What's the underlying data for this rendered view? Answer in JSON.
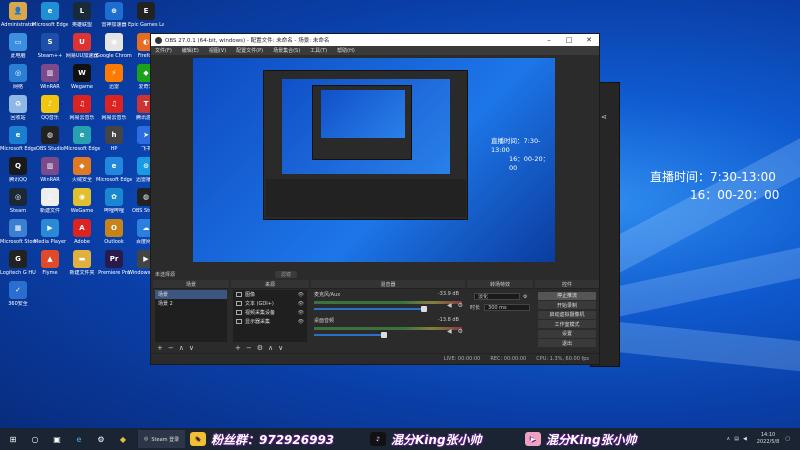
{
  "desktop": {
    "overlay_line1": "直播时间：7:30-13:00",
    "overlay_line2": "16：00-20：00",
    "icons": [
      {
        "label": "Administrator",
        "color": "#d9a64a",
        "glyph": "👤",
        "icon": "user-folder-icon"
      },
      {
        "label": "Microsoft Edge",
        "color": "#1f8fd6",
        "glyph": "e",
        "icon": "edge-icon"
      },
      {
        "label": "英雄联盟",
        "color": "#1a2a3a",
        "glyph": "L",
        "icon": "game-icon"
      },
      {
        "label": "雷神加速器",
        "color": "#1c6fd0",
        "glyph": "⊕",
        "icon": "accelerator-icon"
      },
      {
        "label": "Epic Games Launcher",
        "color": "#222",
        "glyph": "E",
        "icon": "epic-icon"
      },
      {
        "label": "此电脑",
        "color": "#3a8fe0",
        "glyph": "▭",
        "icon": "computer-icon"
      },
      {
        "label": "Steam++",
        "color": "#1d4fa8",
        "glyph": "S",
        "icon": "steam-plus-icon"
      },
      {
        "label": "网易UU加速器",
        "color": "#d33",
        "glyph": "U",
        "icon": "uu-icon"
      },
      {
        "label": "Google Chrome",
        "color": "#e5e5e5",
        "glyph": "◉",
        "icon": "chrome-icon"
      },
      {
        "label": "Firefox",
        "color": "#e86b22",
        "glyph": "◐",
        "icon": "firefox-icon"
      },
      {
        "label": "网络",
        "color": "#2a7fd4",
        "glyph": "◎",
        "icon": "network-icon"
      },
      {
        "label": "WinRAR",
        "color": "#7a4a8a",
        "glyph": "▥",
        "icon": "winrar-icon"
      },
      {
        "label": "Wegame",
        "color": "#111",
        "glyph": "W",
        "icon": "wegame-icon"
      },
      {
        "label": "迅雷",
        "color": "#ff7a00",
        "glyph": "⚡",
        "icon": "thunder-icon"
      },
      {
        "label": "爱奇艺",
        "color": "#1aa31a",
        "glyph": "◆",
        "icon": "iqiyi-icon"
      },
      {
        "label": "回收站",
        "color": "#8fb8e6",
        "glyph": "♻",
        "icon": "recycle-icon"
      },
      {
        "label": "QQ音乐",
        "color": "#f2c511",
        "glyph": "♪",
        "icon": "music-icon"
      },
      {
        "label": "网易云音乐",
        "color": "#d22",
        "glyph": "♫",
        "icon": "netease-icon"
      },
      {
        "label": "网易云音乐",
        "color": "#d22",
        "glyph": "♫",
        "icon": "netease2-icon"
      },
      {
        "label": "腾讯游戏",
        "color": "#c33",
        "glyph": "T",
        "icon": "tencent-icon"
      },
      {
        "label": "Microsoft Edge",
        "color": "#1a7fd0",
        "glyph": "e",
        "icon": "edge2-icon"
      },
      {
        "label": "OBS Studio",
        "color": "#222",
        "glyph": "◍",
        "icon": "obs-icon"
      },
      {
        "label": "Microsoft Edge",
        "color": "#27a0b0",
        "glyph": "e",
        "icon": "edge3-icon"
      },
      {
        "label": "HP",
        "color": "#444",
        "glyph": "h",
        "icon": "hp-icon"
      },
      {
        "label": "飞书",
        "color": "#2d6be0",
        "glyph": "➤",
        "icon": "feishu-icon"
      },
      {
        "label": "腾讯QQ",
        "color": "#1a1a1a",
        "glyph": "Q",
        "icon": "qq-icon"
      },
      {
        "label": "WinRAR",
        "color": "#7a4a8a",
        "glyph": "▥",
        "icon": "winrar2-icon"
      },
      {
        "label": "火绒安全",
        "color": "#e07a22",
        "glyph": "◆",
        "icon": "huorong-icon"
      },
      {
        "label": "Microsoft Edge",
        "color": "#2288dd",
        "glyph": "e",
        "icon": "edge4-icon"
      },
      {
        "label": "迅雷播放",
        "color": "#1a9ae0",
        "glyph": "⊙",
        "icon": "player-icon"
      },
      {
        "label": "Steam",
        "color": "#1b2838",
        "glyph": "◎",
        "icon": "steam-icon"
      },
      {
        "label": "新建文件",
        "color": "#eee",
        "glyph": "▯",
        "icon": "file-icon"
      },
      {
        "label": "WeGame",
        "color": "#e0c030",
        "glyph": "◉",
        "icon": "wegame2-icon"
      },
      {
        "label": "哔哩哔哩",
        "color": "#1a88d0",
        "glyph": "✿",
        "icon": "bilibili-icon"
      },
      {
        "label": "OBS Studio",
        "color": "#222",
        "glyph": "◍",
        "icon": "obs2-icon"
      },
      {
        "label": "Microsoft Store",
        "color": "#3a7fd0",
        "glyph": "▦",
        "icon": "store-icon"
      },
      {
        "label": "Media Player",
        "color": "#2a8ad8",
        "glyph": "▶",
        "icon": "media-icon"
      },
      {
        "label": "Adobe",
        "color": "#d22",
        "glyph": "A",
        "icon": "adobe-icon"
      },
      {
        "label": "Outlook",
        "color": "#c8821a",
        "glyph": "O",
        "icon": "outlook-icon"
      },
      {
        "label": "百度网盘",
        "color": "#2a7fe0",
        "glyph": "☁",
        "icon": "baidu-icon"
      },
      {
        "label": "Logitech G HUB",
        "color": "#222",
        "glyph": "G",
        "icon": "ghub-icon"
      },
      {
        "label": "Flyme",
        "color": "#e04a2a",
        "glyph": "▲",
        "icon": "flyme-icon"
      },
      {
        "label": "新建文件夹",
        "color": "#e0b040",
        "glyph": "▬",
        "icon": "folder-icon"
      },
      {
        "label": "Premiere Pro",
        "color": "#2a1a4a",
        "glyph": "Pr",
        "icon": "premiere-icon"
      },
      {
        "label": "Windows Media",
        "color": "#444",
        "glyph": "▶",
        "icon": "wmp-icon"
      },
      {
        "label": "360安全",
        "color": "#2a6fd0",
        "glyph": "✓",
        "icon": "security-icon"
      }
    ]
  },
  "obs": {
    "title": "OBS 27.0.1 (64-bit, windows) - 配置文件: 未命名 - 场景: 未命名",
    "menu": [
      "文件(F)",
      "编辑(E)",
      "视图(V)",
      "配置文件(P)",
      "场景集合(S)",
      "工具(T)",
      "帮助(H)"
    ],
    "preview_line1": "直播时间：7:30-13:00",
    "preview_line2": "16：00-20：00",
    "no_source_label": "未选择源",
    "filter_button": "滤镜",
    "docks": {
      "scenes_title": "场景",
      "sources_title": "来源",
      "mixer_title": "混音器",
      "transitions_title": "转场特效",
      "controls_title": "控件"
    },
    "scenes": [
      "场景",
      "场景 2"
    ],
    "sources": [
      "图像",
      "文本 (GDI+)",
      "视频采集设备",
      "显示器采集"
    ],
    "mixer": [
      {
        "name": "麦克风/Aux",
        "db": "-33.9 dB"
      },
      {
        "name": "桌面音频",
        "db": "-13.8 dB"
      }
    ],
    "transition": {
      "type": "淡化",
      "duration_label": "时长",
      "duration": "300 ms"
    },
    "controls": [
      "停止推流",
      "开始录制",
      "启动虚拟摄像机",
      "工作室模式",
      "设置",
      "退出"
    ],
    "status": {
      "live": "LIVE: 00:00:00",
      "rec": "REC: 00:00:00",
      "cpu": "CPU: 1.3%, 60.00 fps"
    }
  },
  "taskbar": {
    "steam_label": "Steam 登录",
    "banner1": "粉丝群：972926993",
    "banner2": "混分King张小帅",
    "banner3": "混分King张小帅",
    "time": "14:10",
    "date": "2022/5/8"
  }
}
